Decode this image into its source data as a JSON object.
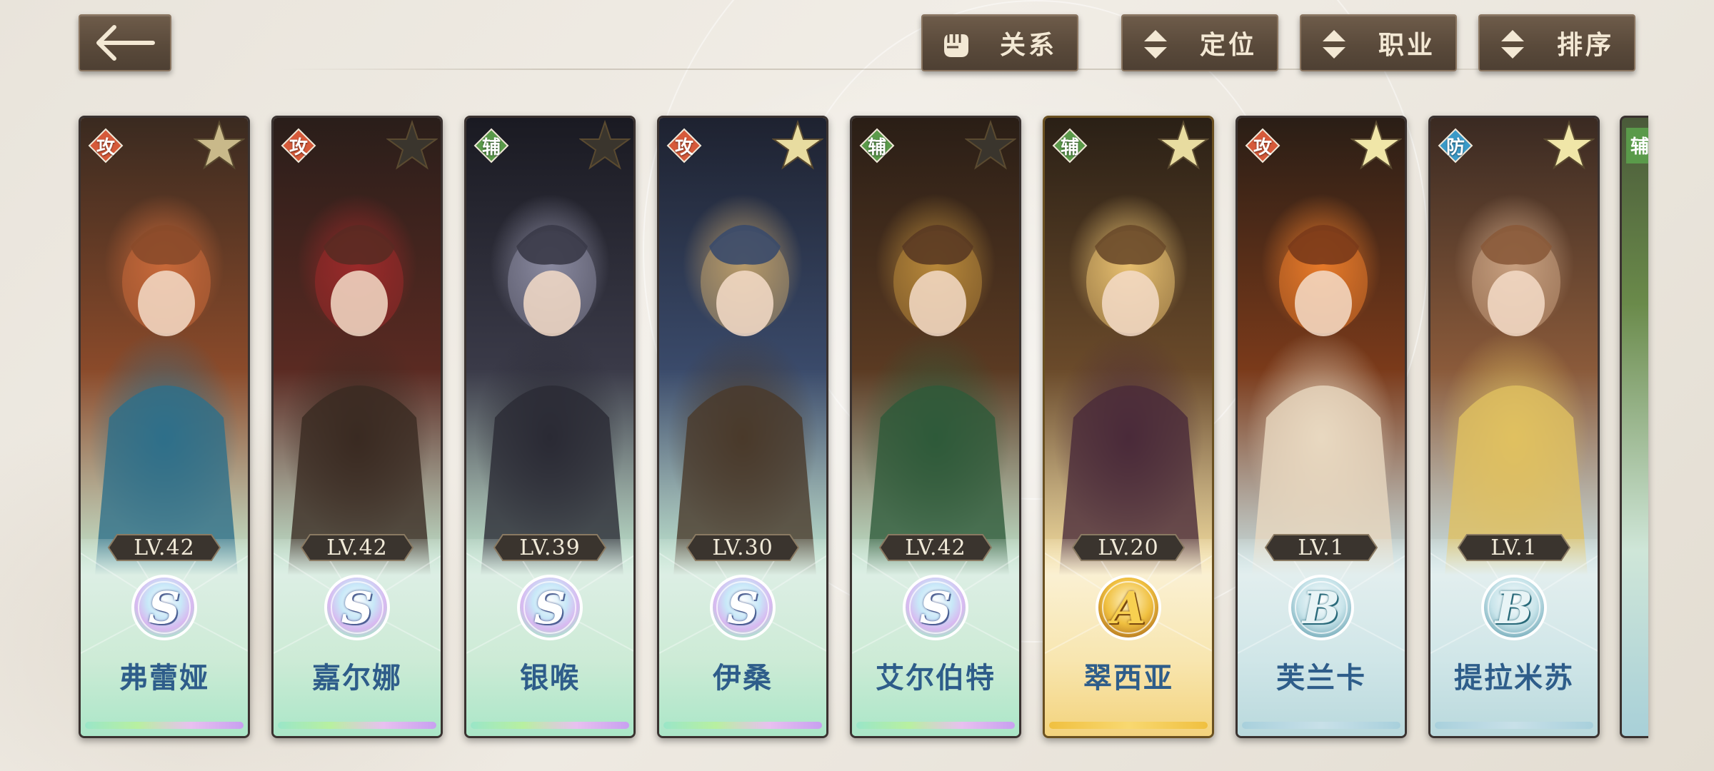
{
  "header": {
    "back_label": "←",
    "filters": [
      {
        "label": "关系",
        "icon": "fist-icon"
      },
      {
        "label": "定位",
        "icon": "sort-arrows-icon"
      },
      {
        "label": "职业",
        "icon": "sort-arrows-icon"
      },
      {
        "label": "排序",
        "icon": "sort-arrows-icon"
      }
    ]
  },
  "characters": [
    {
      "name": "弗蕾娅",
      "level": "LV.42",
      "role": "攻",
      "grade": "S",
      "role_color": "#d65a3a",
      "star_color": "#c9b98a"
    },
    {
      "name": "嘉尔娜",
      "level": "LV.42",
      "role": "攻",
      "grade": "S",
      "role_color": "#d65a3a",
      "star_color": "#3a352d"
    },
    {
      "name": "银喉",
      "level": "LV.39",
      "role": "辅",
      "grade": "S",
      "role_color": "#5a9a4a",
      "star_color": "#3a352d"
    },
    {
      "name": "伊桑",
      "level": "LV.30",
      "role": "攻",
      "grade": "S",
      "role_color": "#d65a3a",
      "star_color": "#e8dca0"
    },
    {
      "name": "艾尔伯特",
      "level": "LV.42",
      "role": "辅",
      "grade": "S",
      "role_color": "#5a9a4a",
      "star_color": "#3a352d"
    },
    {
      "name": "翠西亚",
      "level": "LV.20",
      "role": "辅",
      "grade": "A",
      "role_color": "#5a9a4a",
      "star_color": "#e8dca0"
    },
    {
      "name": "芙兰卡",
      "level": "LV.1",
      "role": "攻",
      "grade": "B",
      "role_color": "#d65a3a",
      "star_color": "#f0e6a8"
    },
    {
      "name": "提拉米苏",
      "level": "LV.1",
      "role": "防",
      "grade": "B",
      "role_color": "#3a9ac8",
      "star_color": "#f0e6a8"
    }
  ],
  "partial_card": {
    "role": "辅"
  }
}
